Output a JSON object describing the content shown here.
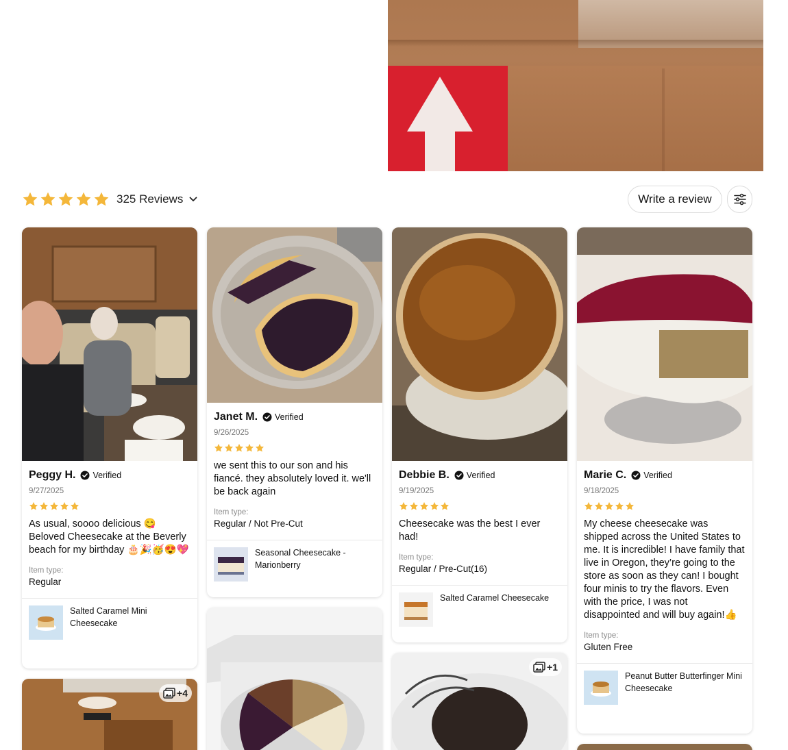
{
  "summary": {
    "reviews_count": "325 Reviews",
    "rating": 5,
    "star_color": "#f4b73a"
  },
  "actions": {
    "write_review": "Write a review"
  },
  "reviews": [
    {
      "name": "Peggy H.",
      "verified": "Verified",
      "date": "9/27/2025",
      "rating": 5,
      "text": "As usual, soooo delicious 😋 Beloved Cheesecake at the Beverly beach for my birthday 🎂🎉🥳😍💖",
      "item_label": "Item type:",
      "item_value": "Regular",
      "product": "Salted Caramel Mini Cheesecake"
    },
    {
      "name": "Janet M.",
      "verified": "Verified",
      "date": "9/26/2025",
      "rating": 5,
      "text": "we sent this to our son and his fiancé. they absolutely loved it. we'll be back again",
      "item_label": "Item type:",
      "item_value": "Regular / Not Pre-Cut",
      "product": "Seasonal Cheesecake - Marionberry"
    },
    {
      "name": "Debbie B.",
      "verified": "Verified",
      "date": "9/19/2025",
      "rating": 5,
      "text": "Cheesecake was the best I ever had!",
      "item_label": "Item type:",
      "item_value": "Regular / Pre-Cut(16)",
      "product": "Salted Caramel Cheesecake"
    },
    {
      "name": "Marie C.",
      "verified": "Verified",
      "date": "9/18/2025",
      "rating": 5,
      "text": "My cheese cheesecake was shipped across the United States to me.  It is incredible!  I have family that live in Oregon, they’re going to the store as soon as they can!  I bought four minis to try the flavors.  Even with the price, I was not disappointed and will buy again!👍",
      "item_label": "Item type:",
      "item_value": "Gluten Free",
      "product": "Peanut Butter Butterfinger Mini Cheesecake"
    }
  ],
  "more_photos": {
    "card5": "+4",
    "card7": "+1"
  }
}
